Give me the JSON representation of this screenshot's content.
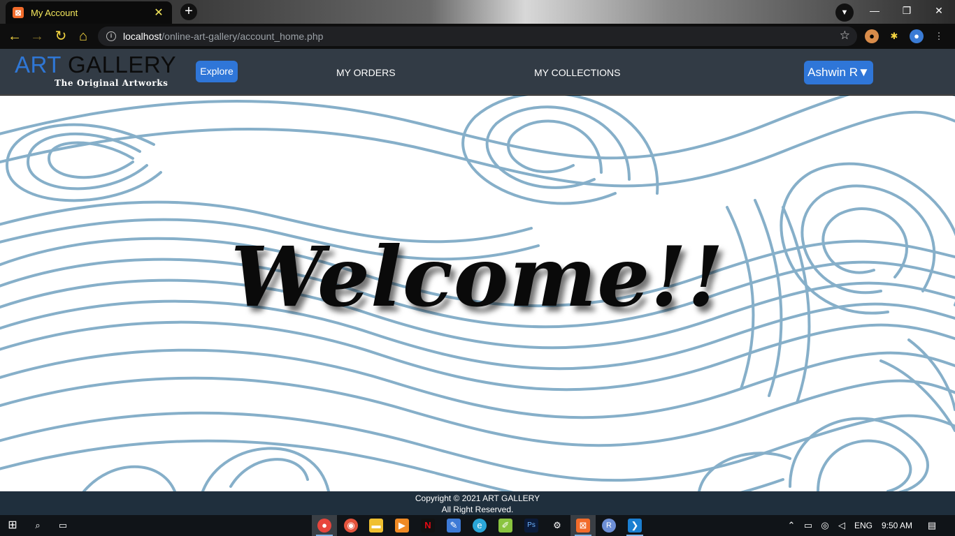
{
  "browser": {
    "tab_title": "My Account",
    "tab_favicon": "xampp-icon",
    "tab_close": "✕",
    "new_tab": "+",
    "url_host": "localhost",
    "url_path": "/online-art-gallery/account_home.php"
  },
  "site": {
    "logo_art": "ART",
    "logo_gallery": "GALLERY",
    "logo_tagline": "The Original Artworks",
    "explore_label": "Explore",
    "nav_orders": "MY ORDERS",
    "nav_collections": "MY COLLECTIONS",
    "user_label": "Ashwin R▼",
    "welcome_text": "Welcome!!",
    "footer_line1": "Copyright © 2021 ART GALLERY",
    "footer_line2": "All Right Reserved.",
    "colors": {
      "accent": "#2f76d8",
      "navbar": "#323b45",
      "footer": "#1f2f3d",
      "wave_stroke": "#86afc9"
    }
  },
  "taskbar": {
    "language": "ENG",
    "time": "9:50 AM",
    "icons": [
      "windows-start-icon",
      "search-icon",
      "task-view-icon",
      "chrome-icon",
      "screen-recorder-icon",
      "file-explorer-icon",
      "media-player-icon",
      "netflix-icon",
      "paint-icon",
      "edge-icon",
      "notepad-icon",
      "photoshop-icon",
      "settings-icon",
      "xampp-icon",
      "r-icon",
      "vscode-icon"
    ]
  }
}
